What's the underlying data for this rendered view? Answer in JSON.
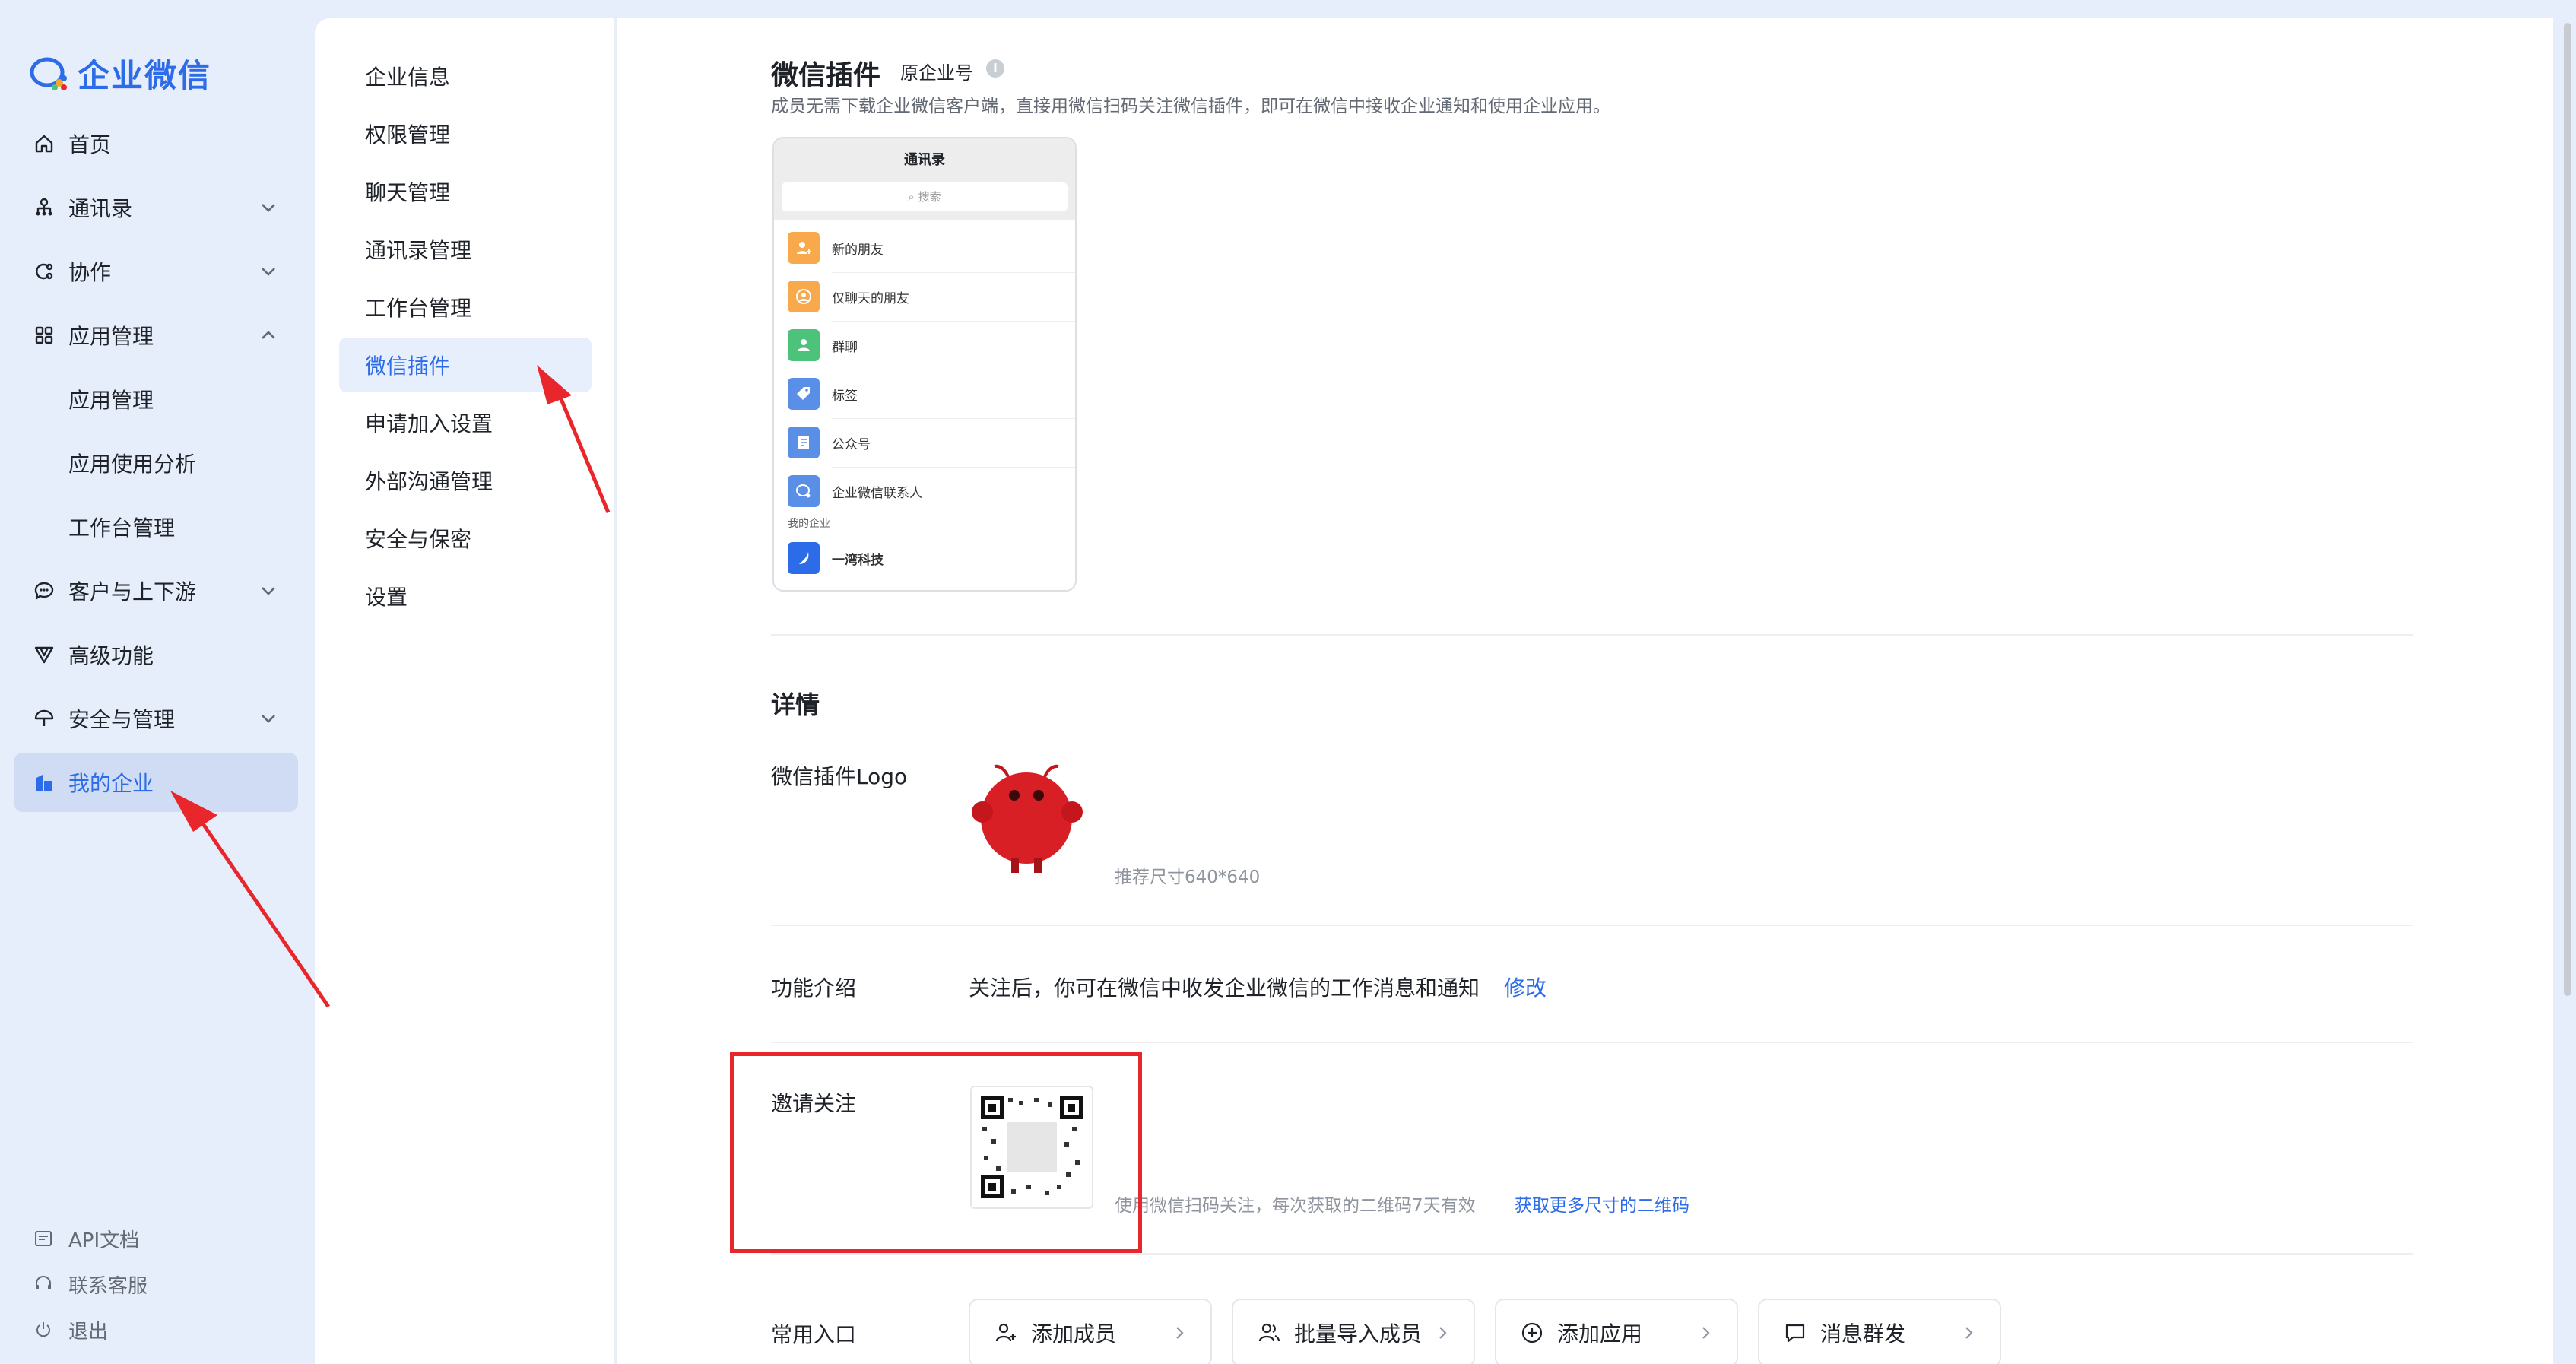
{
  "app": {
    "logo_text": "企业微信",
    "brand_color": "#2d6ce8",
    "accent_red": "#e8262c"
  },
  "sidebar": {
    "items": [
      {
        "label": "首页",
        "icon": "home-icon"
      },
      {
        "label": "通讯录",
        "icon": "org-chart-icon"
      },
      {
        "label": "协作",
        "icon": "collab-icon"
      },
      {
        "label": "应用管理",
        "icon": "grid-icon"
      },
      {
        "label": "应用管理"
      },
      {
        "label": "应用使用分析"
      },
      {
        "label": "工作台管理"
      },
      {
        "label": "客户与上下游",
        "icon": "chat-bubble-icon"
      },
      {
        "label": "高级功能",
        "icon": "v-shape-icon"
      },
      {
        "label": "安全与管理",
        "icon": "umbrella-icon"
      },
      {
        "label": "我的企业",
        "icon": "building-icon"
      }
    ],
    "bottom": [
      {
        "label": "API文档",
        "icon": "api-doc-icon"
      },
      {
        "label": "联系客服",
        "icon": "headset-icon"
      },
      {
        "label": "退出",
        "icon": "power-icon"
      }
    ]
  },
  "subnav": {
    "items": [
      "企业信息",
      "权限管理",
      "聊天管理",
      "通讯录管理",
      "工作台管理",
      "微信插件",
      "申请加入设置",
      "外部沟通管理",
      "安全与保密",
      "设置"
    ]
  },
  "main": {
    "title": "微信插件",
    "title_tag": "原企业号",
    "subtitle": "成员无需下载企业微信客户端，直接用微信扫码关注微信插件，即可在微信中接收企业通知和使用企业应用。",
    "phone": {
      "header": "通讯录",
      "search": "搜索",
      "rows": [
        "新的朋友",
        "仅聊天的朋友",
        "群聊",
        "标签",
        "公众号",
        "企业微信联系人"
      ],
      "section": "我的企业",
      "company": "一湾科技"
    },
    "details": {
      "title": "详情",
      "logo_label": "微信插件Logo",
      "logo_hint": "推荐尺寸640*640",
      "intro_label": "功能介绍",
      "intro_text": "关注后，你可在微信中收发企业微信的工作消息和通知",
      "intro_edit": "修改",
      "invite_label": "邀请关注",
      "invite_hint": "使用微信扫码关注，每次获取的二维码7天有效",
      "invite_link": "获取更多尺寸的二维码",
      "entry_label": "常用入口",
      "entries": [
        {
          "label": "添加成员",
          "icon": "add-user-icon"
        },
        {
          "label": "批量导入成员",
          "icon": "users-icon"
        },
        {
          "label": "添加应用",
          "icon": "plus-circle-icon"
        },
        {
          "label": "消息群发",
          "icon": "message-icon"
        }
      ]
    }
  }
}
